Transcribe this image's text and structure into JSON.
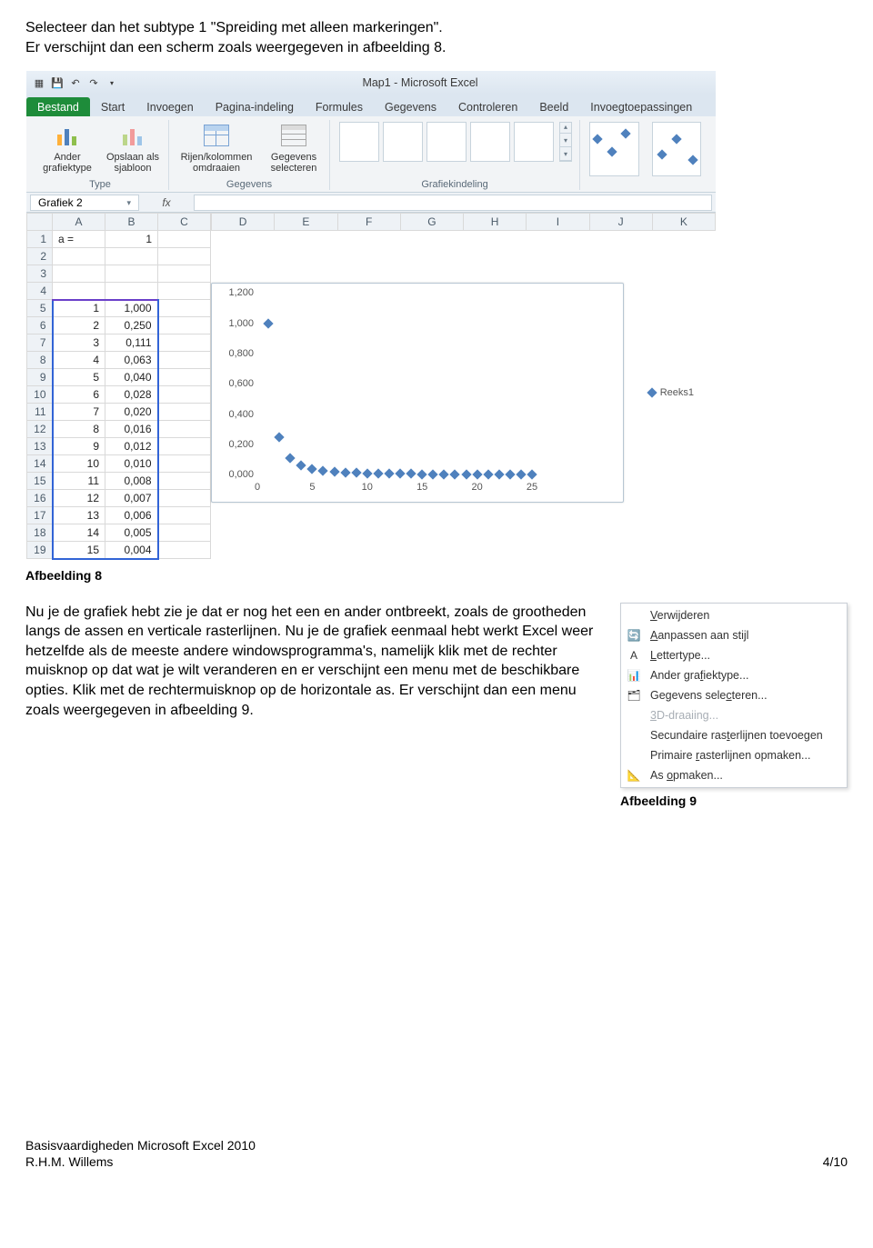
{
  "intro": {
    "line1": "Selecteer dan het subtype 1 \"Spreiding met alleen markeringen\".",
    "line2": "Er verschijnt dan een scherm zoals weergegeven in afbeelding 8."
  },
  "excel": {
    "title": "Map1 - Microsoft Excel",
    "tabs": [
      "Bestand",
      "Start",
      "Invoegen",
      "Pagina-indeling",
      "Formules",
      "Gegevens",
      "Controleren",
      "Beeld",
      "Invoegtoepassingen"
    ],
    "active_tab_index": 0,
    "ribbon": {
      "groups": [
        {
          "name": "Type",
          "buttons": [
            {
              "label": "Ander grafiektype",
              "icon": "ic-chart"
            },
            {
              "label": "Opslaan als sjabloon",
              "icon": "ic-chart2"
            }
          ]
        },
        {
          "name": "Gegevens",
          "buttons": [
            {
              "label": "Rijen/kolommen omdraaien",
              "icon": "ic-table"
            },
            {
              "label": "Gegevens selecteren",
              "icon": "ic-table2"
            }
          ]
        },
        {
          "name": "Grafiekindeling",
          "layout_tiles": 5
        },
        {
          "name": "",
          "preview": true
        }
      ]
    },
    "namebox": "Grafiek 2",
    "fx_label": "fx",
    "columns": [
      "A",
      "B",
      "C",
      "D",
      "E",
      "F",
      "G",
      "H",
      "I",
      "J",
      "K"
    ],
    "rows": [
      {
        "n": 1,
        "a": "a =",
        "b": "1"
      },
      {
        "n": 2,
        "a": "",
        "b": ""
      },
      {
        "n": 3,
        "a": "",
        "b": ""
      },
      {
        "n": 4,
        "a": "",
        "b": ""
      },
      {
        "n": 5,
        "a": "1",
        "b": "1,000"
      },
      {
        "n": 6,
        "a": "2",
        "b": "0,250"
      },
      {
        "n": 7,
        "a": "3",
        "b": "0,111"
      },
      {
        "n": 8,
        "a": "4",
        "b": "0,063"
      },
      {
        "n": 9,
        "a": "5",
        "b": "0,040"
      },
      {
        "n": 10,
        "a": "6",
        "b": "0,028"
      },
      {
        "n": 11,
        "a": "7",
        "b": "0,020"
      },
      {
        "n": 12,
        "a": "8",
        "b": "0,016"
      },
      {
        "n": 13,
        "a": "9",
        "b": "0,012"
      },
      {
        "n": 14,
        "a": "10",
        "b": "0,010"
      },
      {
        "n": 15,
        "a": "11",
        "b": "0,008"
      },
      {
        "n": 16,
        "a": "12",
        "b": "0,007"
      },
      {
        "n": 17,
        "a": "13",
        "b": "0,006"
      },
      {
        "n": 18,
        "a": "14",
        "b": "0,005"
      },
      {
        "n": 19,
        "a": "15",
        "b": "0,004"
      }
    ]
  },
  "chart_data": {
    "type": "scatter",
    "series": [
      {
        "name": "Reeks1",
        "x": [
          1,
          2,
          3,
          4,
          5,
          6,
          7,
          8,
          9,
          10,
          11,
          12,
          13,
          14,
          15,
          16,
          17,
          18,
          19,
          20,
          21,
          22,
          23,
          24,
          25
        ],
        "y": [
          1.0,
          0.25,
          0.111,
          0.063,
          0.04,
          0.028,
          0.02,
          0.016,
          0.012,
          0.01,
          0.008,
          0.007,
          0.006,
          0.005,
          0.004,
          0.004,
          0.003,
          0.003,
          0.003,
          0.003,
          0.002,
          0.002,
          0.002,
          0.002,
          0.002
        ]
      }
    ],
    "xlim": [
      0,
      25
    ],
    "ylim": [
      0,
      1.2
    ],
    "yticks": [
      0.0,
      0.2,
      0.4,
      0.6,
      0.8,
      1.0,
      1.2
    ],
    "ytick_labels": [
      "0,000",
      "0,200",
      "0,400",
      "0,600",
      "0,800",
      "1,000",
      "1,200"
    ],
    "xticks": [
      0,
      5,
      10,
      15,
      20,
      25
    ],
    "legend": "Reeks1",
    "color": "#4f81bd"
  },
  "fig8_caption": "Afbeelding 8",
  "paragraph": "Nu je de grafiek hebt zie je dat er nog het een en ander ontbreekt, zoals de grootheden langs de assen en verticale rasterlijnen. Nu je de grafiek eenmaal hebt werkt Excel weer hetzelfde als de meeste andere windowsprogramma's, namelijk klik met de rechter muisknop op dat wat je wilt veranderen en er verschijnt een menu met de beschikbare opties. Klik met de rechtermuisknop op de horizontale as. Er verschijnt dan een menu zoals weergegeven in afbeelding 9.",
  "context_menu": {
    "items": [
      {
        "label_pre": "",
        "u": "V",
        "label_post": "erwijderen",
        "disabled": false,
        "icon": ""
      },
      {
        "label_pre": "",
        "u": "A",
        "label_post": "anpassen aan stijl",
        "disabled": false,
        "icon": "🔄"
      },
      {
        "label_pre": "",
        "u": "L",
        "label_post": "ettertype...",
        "disabled": false,
        "icon": "A"
      },
      {
        "label_pre": "Ander gra",
        "u": "f",
        "label_post": "iektype...",
        "disabled": false,
        "icon": "📊"
      },
      {
        "label_pre": "Gegevens sele",
        "u": "c",
        "label_post": "teren...",
        "disabled": false,
        "icon": "🗂"
      },
      {
        "label_pre": "",
        "u": "3",
        "label_post": "D-draaiing...",
        "disabled": true,
        "icon": ""
      },
      {
        "label_pre": "Secundaire ras",
        "u": "t",
        "label_post": "erlijnen toevoegen",
        "disabled": false,
        "icon": ""
      },
      {
        "label_pre": "Primaire ",
        "u": "r",
        "label_post": "asterlijnen opmaken...",
        "disabled": false,
        "icon": ""
      },
      {
        "label_pre": "As ",
        "u": "o",
        "label_post": "pmaken...",
        "disabled": false,
        "icon": "📐"
      }
    ]
  },
  "fig9_caption": "Afbeelding 9",
  "footer": {
    "left1": "Basisvaardigheden Microsoft Excel 2010",
    "left2": "R.H.M. Willems",
    "right": "4/10"
  }
}
